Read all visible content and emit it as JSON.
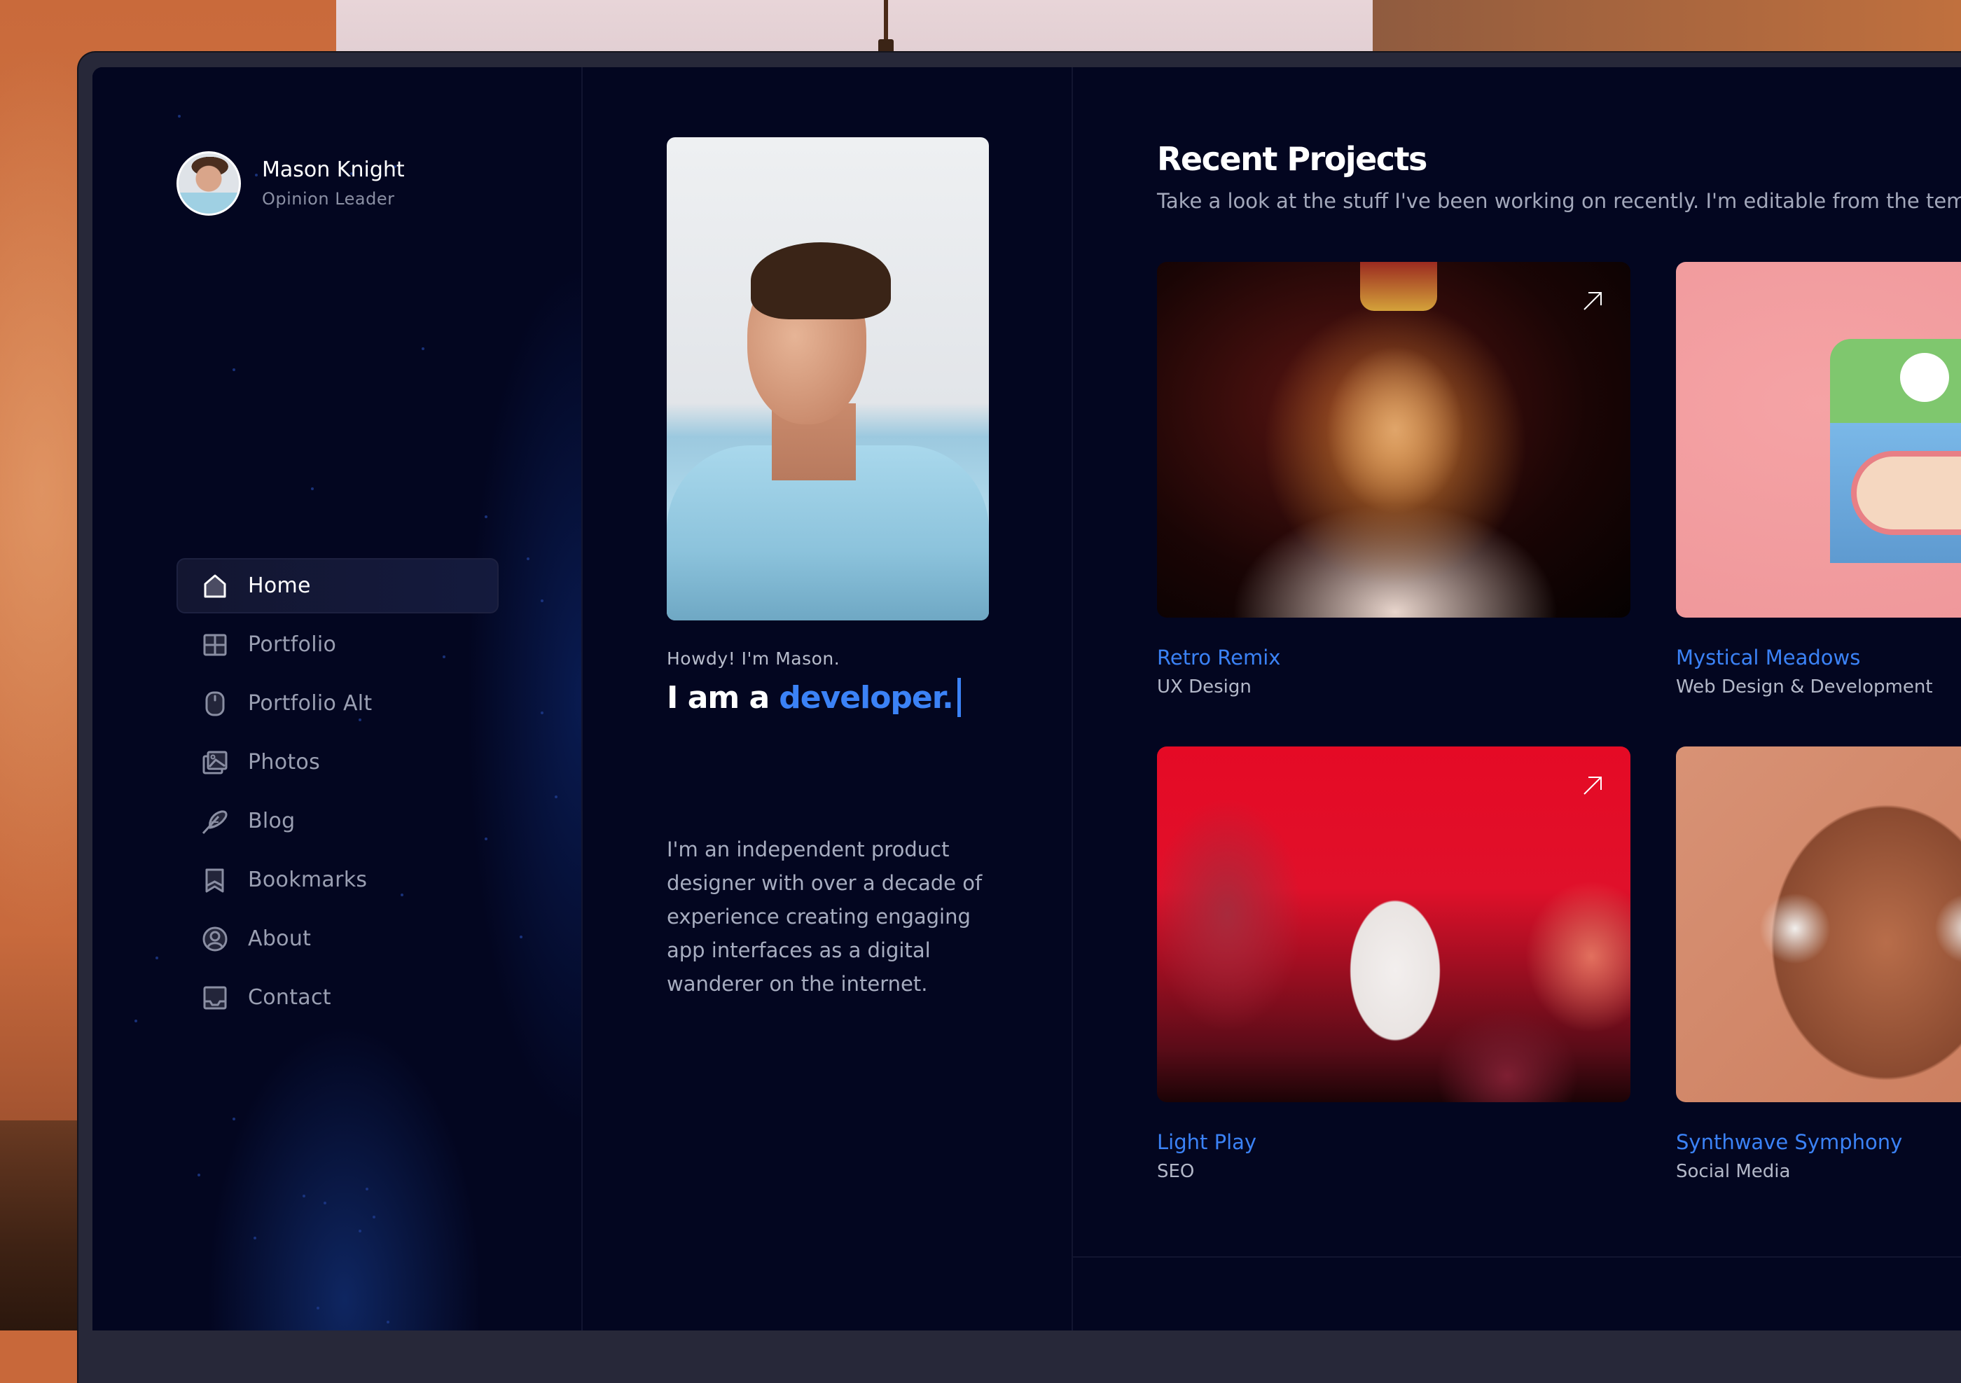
{
  "profile": {
    "name": "Mason Knight",
    "role": "Opinion Leader"
  },
  "nav": {
    "items": [
      {
        "label": "Home",
        "icon": "home-icon",
        "active": true
      },
      {
        "label": "Portfolio",
        "icon": "grid-icon",
        "active": false
      },
      {
        "label": "Portfolio Alt",
        "icon": "mouse-icon",
        "active": false
      },
      {
        "label": "Photos",
        "icon": "photos-icon",
        "active": false
      },
      {
        "label": "Blog",
        "icon": "feather-icon",
        "active": false
      },
      {
        "label": "Bookmarks",
        "icon": "bookmark-icon",
        "active": false
      },
      {
        "label": "About",
        "icon": "user-circle-icon",
        "active": false
      },
      {
        "label": "Contact",
        "icon": "inbox-icon",
        "active": false
      }
    ]
  },
  "intro": {
    "greeting": "Howdy! I'm Mason.",
    "headline_prefix": "I am a",
    "headline_accent": "developer.",
    "bio": "I'm an independent product designer with over a decade of experience creating engaging app interfaces as a digital wanderer on the internet."
  },
  "projects": {
    "title": "Recent Projects",
    "subtitle": "Take a look at the stuff I've been working on recently. I'm editable from the templa",
    "items": [
      {
        "title": "Retro Remix",
        "category": "UX Design",
        "image": "lion-king-render"
      },
      {
        "title": "Mystical Meadows",
        "category": "Web Design & Development",
        "image": "pink-robot-render"
      },
      {
        "title": "Light Play",
        "category": "SEO",
        "image": "bunny-lanterns-render"
      },
      {
        "title": "Synthwave Symphony",
        "category": "Social Media",
        "image": "cartoon-face-render"
      }
    ]
  },
  "colors": {
    "background": "#030620",
    "accent": "#3b82f6",
    "bezel": "#272839",
    "text_primary": "#ffffff",
    "text_muted": "#a7adc0"
  }
}
